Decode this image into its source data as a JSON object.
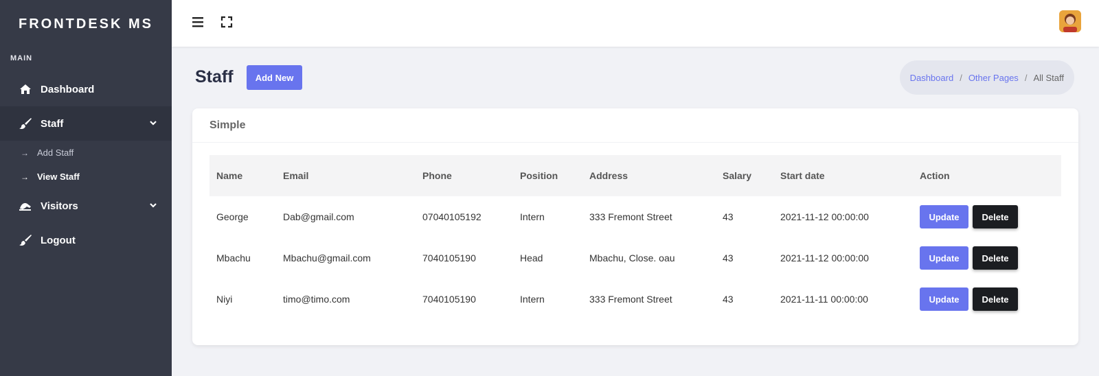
{
  "sidebar": {
    "brand": "FRONTDESK MS",
    "section_title": "MAIN",
    "items": [
      {
        "label": "Dashboard",
        "icon": "home-icon"
      },
      {
        "label": "Staff",
        "icon": "brush-icon"
      },
      {
        "label": "Visitors",
        "icon": "visitors-icon"
      },
      {
        "label": "Logout",
        "icon": "brush-icon"
      }
    ],
    "staff_sub": [
      {
        "label": "Add Staff"
      },
      {
        "label": "View Staff"
      }
    ]
  },
  "topbar": {
    "menu_icon": "hamburger-icon",
    "fullscreen_icon": "fullscreen-icon",
    "avatar": "user-avatar"
  },
  "page": {
    "title": "Staff",
    "add_new_label": "Add New"
  },
  "breadcrumb": {
    "items": [
      "Dashboard",
      "Other Pages"
    ],
    "current": "All Staff",
    "separator": "/"
  },
  "card": {
    "title": "Simple"
  },
  "table": {
    "headers": [
      "Name",
      "Email",
      "Phone",
      "Position",
      "Address",
      "Salary",
      "Start date",
      "Action"
    ],
    "rows": [
      {
        "name": "George",
        "email": "Dab@gmail.com",
        "phone": "07040105192",
        "position": "Intern",
        "address": "333 Fremont Street",
        "salary": "43",
        "start_date": "2021-11-12 00:00:00"
      },
      {
        "name": "Mbachu",
        "email": "Mbachu@gmail.com",
        "phone": "7040105190",
        "position": "Head",
        "address": "Mbachu, Close. oau",
        "salary": "43",
        "start_date": "2021-11-12 00:00:00"
      },
      {
        "name": "Niyi",
        "email": "timo@timo.com",
        "phone": "7040105190",
        "position": "Intern",
        "address": "333 Fremont Street",
        "salary": "43",
        "start_date": "2021-11-11 00:00:00"
      }
    ],
    "update_label": "Update",
    "delete_label": "Delete"
  },
  "colors": {
    "sidebar_bg": "#363a47",
    "accent": "#6874ee",
    "delete_bg": "#1b1d21"
  }
}
